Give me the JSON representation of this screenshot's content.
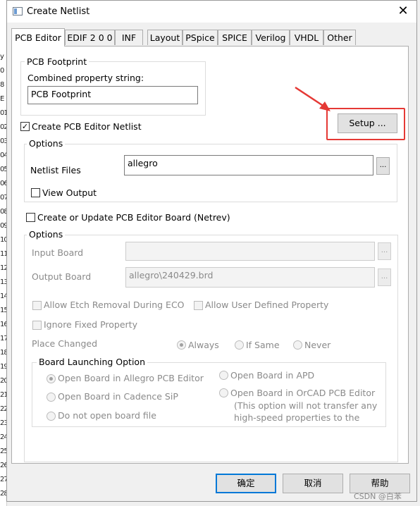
{
  "window": {
    "title": "Create Netlist"
  },
  "tabs": [
    "PCB Editor",
    "EDIF 2 0 0",
    "INF",
    "Layout",
    "PSpice",
    "SPICE",
    "Verilog",
    "VHDL",
    "Other"
  ],
  "pcb_footprint": {
    "group_title": "PCB Footprint",
    "label": "Combined property string:",
    "value": "PCB Footprint"
  },
  "create_netlist": {
    "label": "Create PCB Editor Netlist",
    "checked": true
  },
  "setup_button": "Setup ...",
  "options1": {
    "title": "Options",
    "netlist_files_label": "Netlist Files",
    "netlist_files_value": "allegro",
    "browse": "...",
    "view_output_label": "View Output"
  },
  "create_board": {
    "label": "Create or Update PCB Editor Board (Netrev)"
  },
  "options2": {
    "title": "Options",
    "input_board_label": "Input Board",
    "input_board_value": "",
    "output_board_label": "Output Board",
    "output_board_value": "allegro\\240429.brd",
    "browse": "...",
    "allow_etch": "Allow Etch Removal During ECO",
    "allow_user": "Allow User Defined Property",
    "ignore_fixed": "Ignore Fixed Property",
    "place_changed": "Place Changed",
    "always": "Always",
    "if_same": "If Same",
    "never": "Never"
  },
  "launch": {
    "title": "Board Launching Option",
    "open_allegro": "Open Board in Allegro PCB Editor",
    "open_apd": "Open Board in APD",
    "open_sip": "Open Board in Cadence SiP",
    "open_orcad": "Open Board in OrCAD PCB Editor",
    "orcad_note_1": "(This option will not transfer any",
    "orcad_note_2": "high-speed properties to the",
    "no_open": "Do not open board file"
  },
  "footer": {
    "ok": "确定",
    "cancel": "取消",
    "help": "帮助"
  },
  "watermark": "CSDN @白苯",
  "highlight_color": "#e53935"
}
